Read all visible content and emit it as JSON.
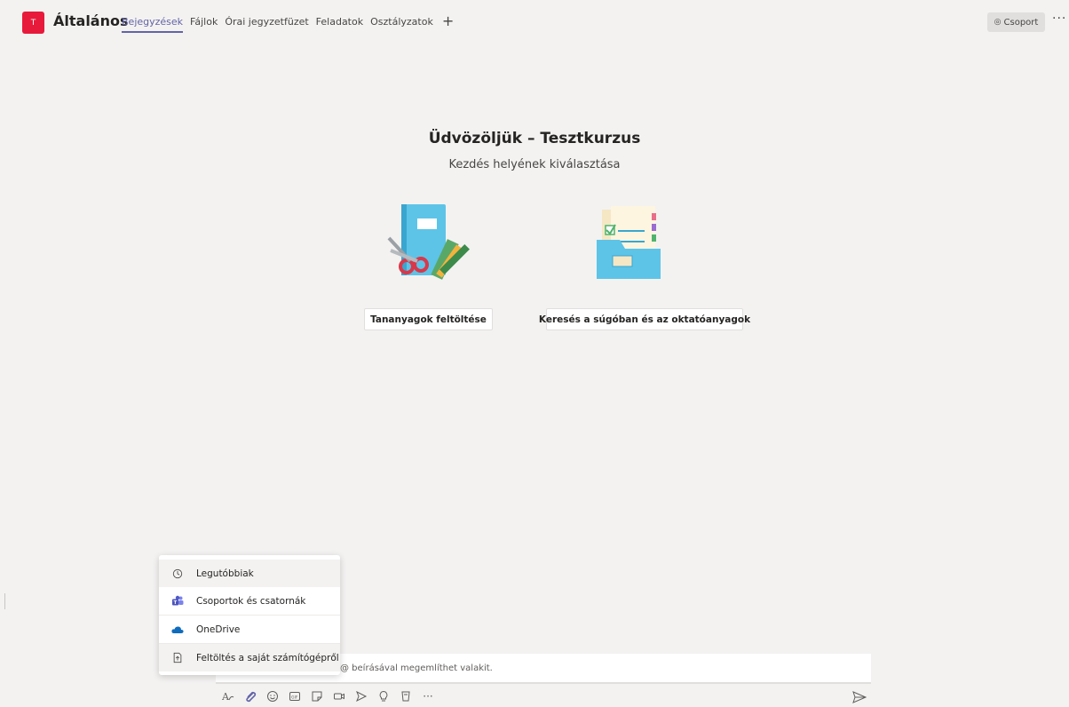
{
  "header": {
    "team_initial": "T",
    "channel_title": "Általános",
    "tabs": [
      {
        "label": "Bejegyzések",
        "active": true
      },
      {
        "label": "Fájlok",
        "active": false
      },
      {
        "label": "Órai jegyzetfüzet",
        "active": false
      },
      {
        "label": "Feladatok",
        "active": false
      },
      {
        "label": "Osztályzatok",
        "active": false
      }
    ],
    "add_tab": "+",
    "team_button": "Csoport",
    "more": "···"
  },
  "welcome": {
    "title": "Üdvözöljük – Tesztkurzus",
    "subtitle": "Kezdés helyének kiválasztása",
    "upload_button": "Tananyagok feltöltése",
    "search_button": "Keresés a súgóban és az oktatóanyagok"
  },
  "compose": {
    "placeholder": "@ beírásával megemlíthet valakit."
  },
  "attach_menu": {
    "items": [
      {
        "label": "Legutóbbiak",
        "icon": "clock-icon"
      },
      {
        "label": "Csoportok és csatornák",
        "icon": "teams-icon"
      },
      {
        "label": "OneDrive",
        "icon": "onedrive-icon"
      },
      {
        "label": "Feltöltés a saját számítógépről",
        "icon": "upload-icon"
      }
    ]
  },
  "toolbar": {
    "more": "···"
  },
  "colors": {
    "accent": "#6264a7",
    "team_avatar": "#e81a3b",
    "background": "#f3f2f1"
  }
}
